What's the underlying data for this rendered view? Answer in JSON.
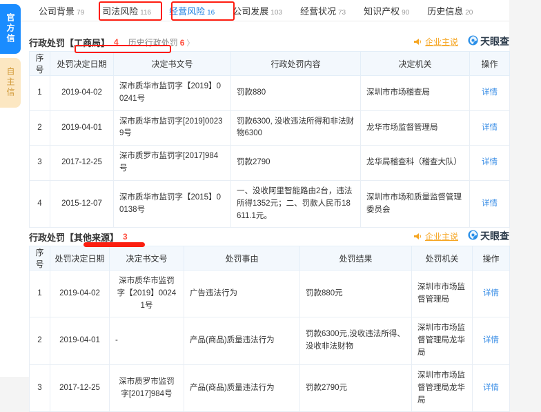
{
  "side_tabs": [
    {
      "label": "官方信息",
      "active": true
    },
    {
      "label": "自主信息",
      "active": false
    }
  ],
  "top_nav": {
    "tabs": [
      {
        "label": "公司背景",
        "count": "79",
        "active": false
      },
      {
        "label": "司法风险",
        "count": "116",
        "active": false
      },
      {
        "label": "经营风险",
        "count": "16",
        "active": true
      },
      {
        "label": "公司发展",
        "count": "103",
        "active": false
      },
      {
        "label": "经营状况",
        "count": "73",
        "active": false
      },
      {
        "label": "知识产权",
        "count": "90",
        "active": false
      },
      {
        "label": "历史信息",
        "count": "20",
        "active": false
      }
    ]
  },
  "brand": {
    "owner_say_label": "企业主说",
    "owner_say_icon": "megaphone-icon",
    "name": "天眼查",
    "logo_icon": "tianyancha-logo-icon"
  },
  "sections": [
    {
      "title": "行政处罚【工商局】",
      "count": "4",
      "sub_label": "历史行政处罚",
      "sub_count": "6",
      "sub_arrow": "〉",
      "columns": [
        "序号",
        "处罚决定日期",
        "决定书文号",
        "行政处罚内容",
        "决定机关",
        "操作"
      ],
      "rows": [
        {
          "index": "1",
          "date": "2019-04-02",
          "doc_no": "深市质华市监罚字【2019】00241号",
          "content": "罚款880",
          "authority": "深圳市市场稽查局",
          "action": "详情"
        },
        {
          "index": "2",
          "date": "2019-04-01",
          "doc_no": "深市质华市监罚字[2019]00239号",
          "content": "罚款6300, 没收违法所得和非法财物6300",
          "authority": "龙华市场监督管理局",
          "action": "详情"
        },
        {
          "index": "3",
          "date": "2017-12-25",
          "doc_no": "深市质罗市监罚字[2017]984号",
          "content": "罚款2790",
          "authority": "龙华局稽查科（稽查大队）",
          "action": "详情"
        },
        {
          "index": "4",
          "date": "2015-12-07",
          "doc_no": "深市质华市监罚字【2015】00138号",
          "content": "一、没收阿里智能路由2台，违法所得1352元；二、罚款人民币18611.1元。",
          "authority": "深圳市市场和质量监督管理委员会",
          "action": "详情"
        }
      ]
    },
    {
      "title": "行政处罚【其他来源】",
      "count": "3",
      "columns": [
        "序号",
        "处罚决定日期",
        "决定书文号",
        "处罚事由",
        "处罚结果",
        "处罚机关",
        "操作"
      ],
      "rows": [
        {
          "index": "1",
          "date": "2019-04-02",
          "doc_no": "深市质华市监罚字【2019】00241号",
          "reason": "广告违法行为",
          "result": "罚款880元",
          "authority": "深圳市市场监督管理局",
          "action": "详情"
        },
        {
          "index": "2",
          "date": "2019-04-01",
          "doc_no": "-",
          "reason": "产品(商品)质量违法行为",
          "result": "罚款6300元,没收违法所得、没收非法财物",
          "authority": "深圳市市场监督管理局龙华局",
          "action": "详情"
        },
        {
          "index": "3",
          "date": "2017-12-25",
          "doc_no": "深市质罗市监罚字[2017]984号",
          "reason": "产品(商品)质量违法行为",
          "result": "罚款2790元",
          "authority": "深圳市市场监督管理局龙华局",
          "action": "详情"
        }
      ]
    }
  ],
  "colors": {
    "accent_blue": "#1a8cff",
    "link_blue": "#3a8ee6",
    "red": "#ff4d3d",
    "annotation_red": "#fb1f10",
    "orange": "#f6a623",
    "side_secondary_bg": "#fce7c2"
  }
}
